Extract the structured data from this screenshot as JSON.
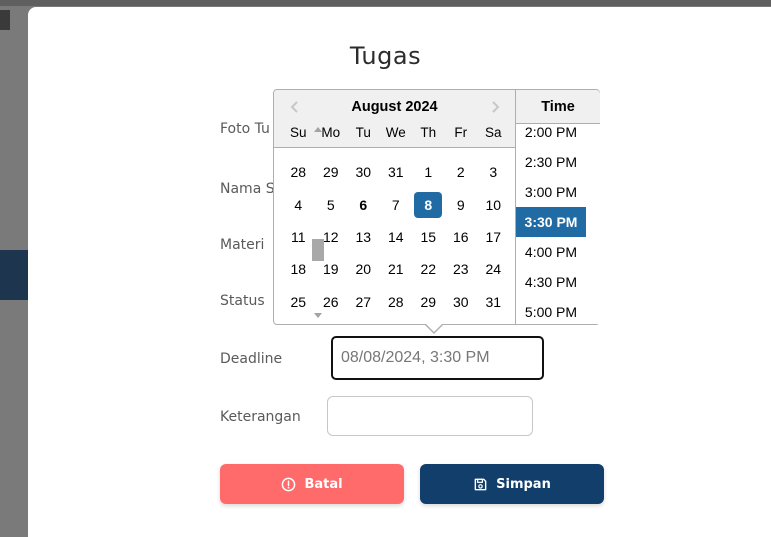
{
  "modal": {
    "title": "Tugas"
  },
  "form": {
    "labels": {
      "foto": "Foto Tu",
      "nama": "Nama S",
      "materi": "Materi",
      "status": "Status",
      "deadline": "Deadline",
      "keterangan": "Keterangan"
    },
    "deadline_value": "08/08/2024, 3:30 PM",
    "keterangan_value": ""
  },
  "buttons": {
    "batal": "Batal",
    "simpan": "Simpan"
  },
  "datepicker": {
    "month_label": "August 2024",
    "days_of_week": [
      "Su",
      "Mo",
      "Tu",
      "We",
      "Th",
      "Fr",
      "Sa"
    ],
    "weeks": [
      [
        "28",
        "29",
        "30",
        "31",
        "1",
        "2",
        "3"
      ],
      [
        "4",
        "5",
        "6",
        "7",
        "8",
        "9",
        "10"
      ],
      [
        "11",
        "12",
        "13",
        "14",
        "15",
        "16",
        "17"
      ],
      [
        "18",
        "19",
        "20",
        "21",
        "22",
        "23",
        "24"
      ],
      [
        "25",
        "26",
        "27",
        "28",
        "29",
        "30",
        "31"
      ]
    ],
    "selected_day": "8",
    "today_day": "6",
    "time_header": "Time",
    "times": [
      "2:00 PM",
      "2:30 PM",
      "3:00 PM",
      "3:30 PM",
      "4:00 PM",
      "4:30 PM",
      "5:00 PM"
    ],
    "selected_time": "3:30 PM"
  },
  "colors": {
    "batal": "#ff6b6b",
    "simpan": "#123e6b",
    "selected": "#216ba5"
  }
}
